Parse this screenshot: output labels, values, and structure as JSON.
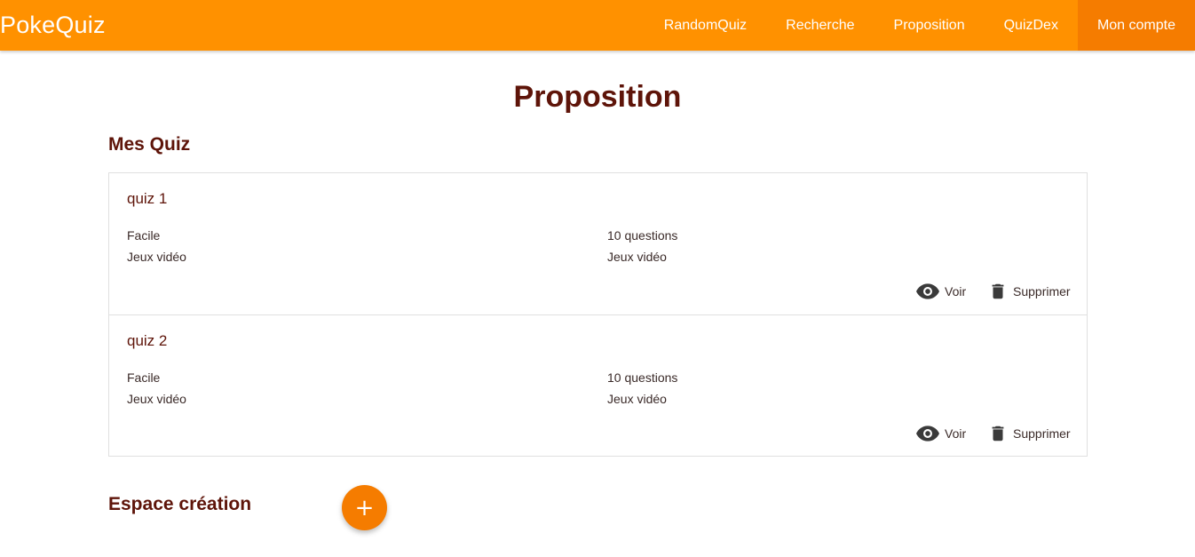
{
  "app": {
    "brand": "PokeQuiz"
  },
  "nav": {
    "items": [
      {
        "label": "RandomQuiz"
      },
      {
        "label": "Recherche"
      },
      {
        "label": "Proposition"
      },
      {
        "label": "QuizDex"
      },
      {
        "label": "Mon compte",
        "active": true
      }
    ]
  },
  "page": {
    "title": "Proposition",
    "my_quiz_title": "Mes Quiz",
    "creation_title": "Espace création",
    "add_button_label": "+"
  },
  "quizzes": [
    {
      "name": "quiz 1",
      "difficulty": "Facile",
      "category": "Jeux vidéo",
      "questions": "10 questions",
      "category2": "Jeux vidéo",
      "view_label": "Voir",
      "delete_label": "Supprimer"
    },
    {
      "name": "quiz 2",
      "difficulty": "Facile",
      "category": "Jeux vidéo",
      "questions": "10 questions",
      "category2": "Jeux vidéo",
      "view_label": "Voir",
      "delete_label": "Supprimer"
    }
  ],
  "icons": {
    "view": "eye-icon",
    "delete": "trash-icon",
    "add": "plus-icon"
  },
  "colors": {
    "navbar": "#ff9100",
    "navbar_active": "#f57c00",
    "accent": "#f57c00",
    "title_text": "#5e1409"
  }
}
